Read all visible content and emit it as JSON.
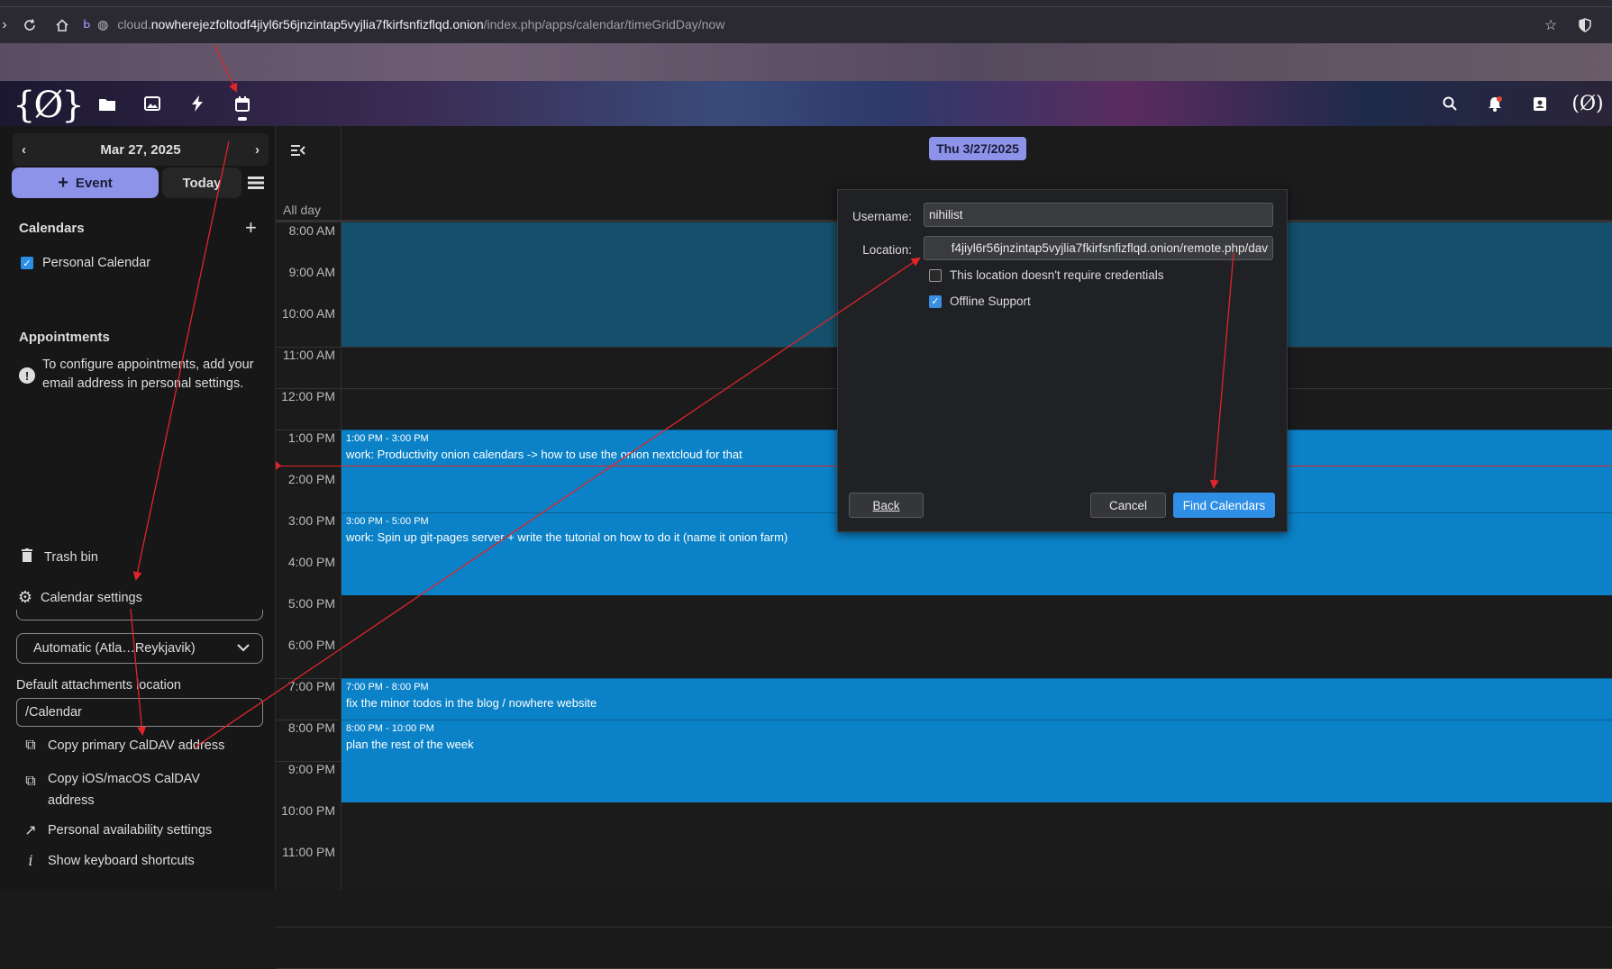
{
  "browser": {
    "url_scheme_host_prefix": "cloud.",
    "url_host": "nowherejezfoltodf4jiyl6r56jnzintap5vyjlia7fkirfsnfizflqd.onion",
    "url_path": "/index.php/apps/calendar/timeGridDay/now"
  },
  "header": {
    "logo_text": "{Ø}",
    "apps": [
      {
        "icon": "folder-icon"
      },
      {
        "icon": "image-icon"
      },
      {
        "icon": "lightning-icon"
      },
      {
        "icon": "calendar-icon"
      }
    ],
    "right_icons": [
      "search-icon",
      "bell-icon",
      "contacts-icon",
      "avatar-icon"
    ],
    "avatar_text": "(Ø)"
  },
  "sidebar": {
    "date_label": "Mar 27, 2025",
    "event_button": "Event",
    "today_button": "Today",
    "calendars_title": "Calendars",
    "calendars": [
      {
        "label": "Personal Calendar",
        "checked": true,
        "color": "#2b8fe6"
      }
    ],
    "appointments_title": "Appointments",
    "appointments_note": "To configure appointments, add your email address in personal settings.",
    "trash_label": "Trash bin",
    "settings_label": "Calendar settings",
    "timezone_value": "Automatic (Atla…Reykjavik)",
    "attachments_label": "Default attachments location",
    "attachments_value": "/Calendar",
    "copy_caldav": "Copy primary CalDAV address",
    "copy_ios_caldav": "Copy iOS/macOS CalDAV address",
    "availability": "Personal availability settings",
    "shortcuts": "Show keyboard shortcuts"
  },
  "calendar": {
    "day_badge": "Thu 3/27/2025",
    "allday_label": "All day",
    "hours": [
      "8:00 AM",
      "9:00 AM",
      "10:00 AM",
      "11:00 AM",
      "12:00 PM",
      "1:00 PM",
      "2:00 PM",
      "3:00 PM",
      "4:00 PM",
      "5:00 PM",
      "6:00 PM",
      "7:00 PM",
      "8:00 PM",
      "9:00 PM",
      "10:00 PM",
      "11:00 PM"
    ],
    "events": [
      {
        "time": "1:00 PM - 3:00 PM",
        "title": "work: Productivity onion calendars -> how to use the onion nextcloud for that"
      },
      {
        "time": "3:00 PM - 5:00 PM",
        "title": "work: Spin up git-pages server + write the tutorial on how to do it (name it onion farm)"
      },
      {
        "time": "7:00 PM - 8:00 PM",
        "title": "fix the minor todos in the blog / nowhere website"
      },
      {
        "time": "8:00 PM - 10:00 PM",
        "title": "plan the rest of the week"
      }
    ]
  },
  "dialog": {
    "username_label": "Username:",
    "username_value": "nihilist",
    "location_label": "Location:",
    "location_value": "f4jiyl6r56jnzintap5vyjlia7fkirfsnfizflqd.onion/remote.php/dav",
    "no_credentials_label": "This location doesn't require credentials",
    "no_credentials_checked": false,
    "offline_label": "Offline Support",
    "offline_checked": true,
    "back_button": "Back",
    "cancel_button": "Cancel",
    "find_button": "Find Calendars"
  }
}
